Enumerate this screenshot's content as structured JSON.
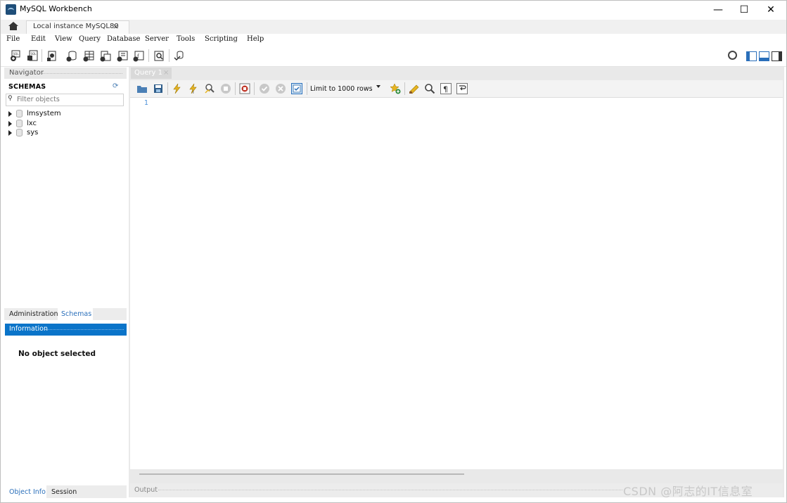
{
  "window": {
    "title": "MySQL Workbench",
    "controls": {
      "minimize": "—",
      "maximize": "☐",
      "close": "✕"
    }
  },
  "tabs": {
    "connection": "Local instance MySQL80",
    "close": "×"
  },
  "menu": [
    "File",
    "Edit",
    "View",
    "Query",
    "Database",
    "Server",
    "Tools",
    "Scripting",
    "Help"
  ],
  "navigator": {
    "header": "Navigator",
    "schemas_title": "SCHEMAS",
    "filter_placeholder": "Filter objects",
    "schemas": [
      {
        "name": "lmsystem"
      },
      {
        "name": "lxc"
      },
      {
        "name": "sys"
      }
    ],
    "lower_tabs": [
      "Administration",
      "Schemas"
    ],
    "info_header": "Information",
    "no_object": "No object selected",
    "bottom_tabs": [
      "Object Info",
      "Session"
    ]
  },
  "editor": {
    "query_tab": "Query 1",
    "query_tab_close": "×",
    "limit_label": "Limit to 1000 rows",
    "line_number": "1",
    "output_label": "Output"
  },
  "watermark": "CSDN @阿志的IT信息室",
  "colors": {
    "accent": "#0a74c9",
    "info_header_bg": "#0a74c9",
    "line_number": "#4a8fd8"
  },
  "icons": {
    "toolbar": [
      "new-sql-tab-icon",
      "open-sql-script-icon",
      "inspector-icon",
      "create-schema-icon",
      "create-table-icon",
      "create-view-icon",
      "create-procedure-icon",
      "create-function-icon",
      "search-table-data-icon",
      "reconnect-icon"
    ],
    "query_toolbar": [
      "open-file-icon",
      "save-icon",
      "execute-icon",
      "execute-current-icon",
      "explain-icon",
      "stop-icon",
      "toggle-error-stop-icon",
      "commit-icon",
      "rollback-icon",
      "autocommit-icon",
      "add-snippet-icon",
      "beautify-icon",
      "find-icon",
      "invisible-chars-icon",
      "wrap-lines-icon"
    ]
  }
}
